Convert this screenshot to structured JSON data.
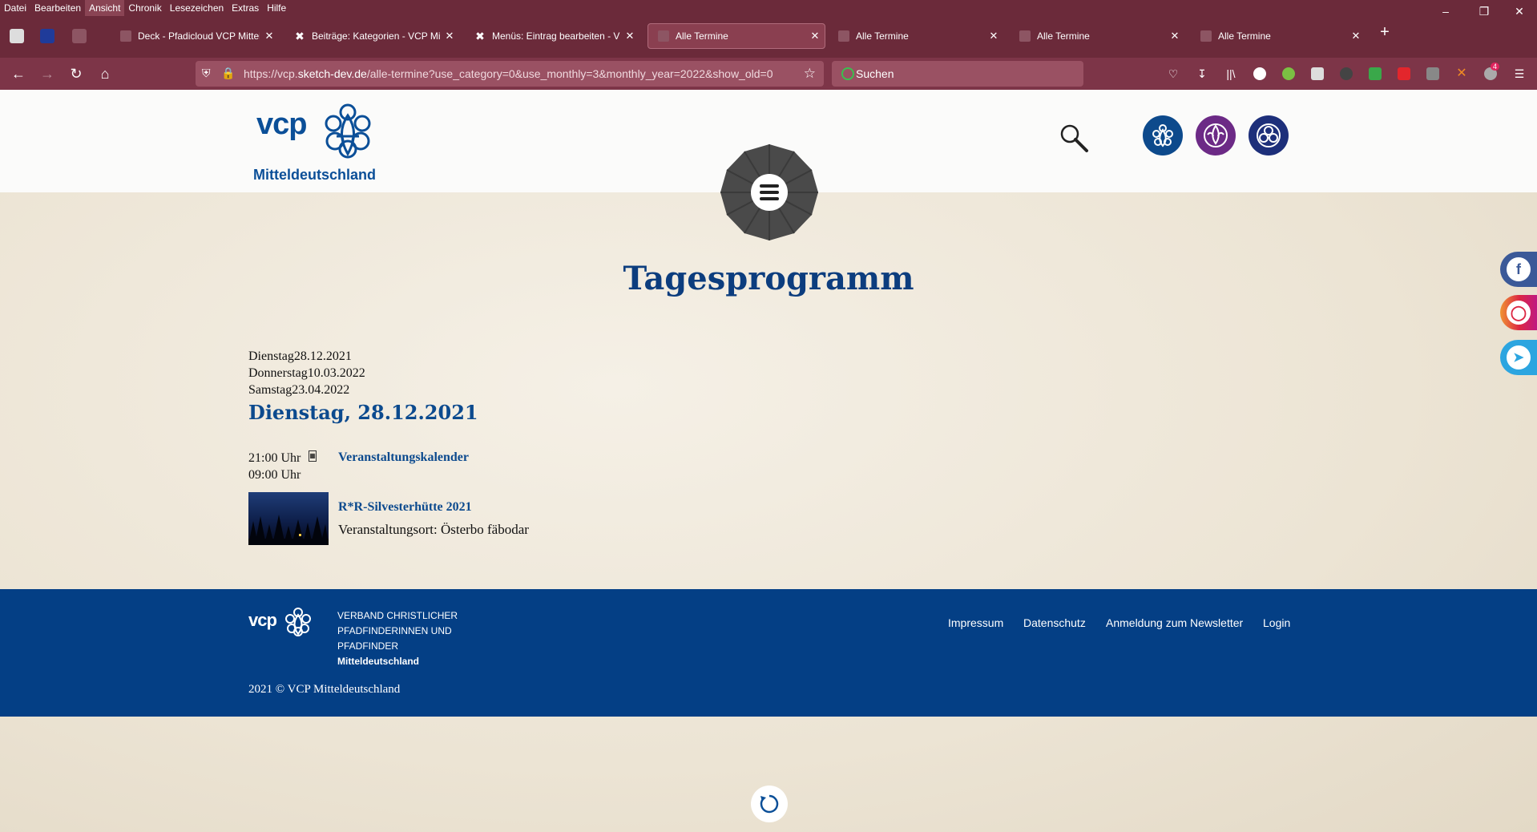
{
  "browser": {
    "menu": [
      "Datei",
      "Bearbeiten",
      "Ansicht",
      "Chronik",
      "Lesezeichen",
      "Extras",
      "Hilfe"
    ],
    "tabs": [
      {
        "label": "Deck - Pfadicloud VCP Mitteldeutschland"
      },
      {
        "label": "Beiträge: Kategorien - VCP Mitteldeutschland"
      },
      {
        "label": "Menüs: Eintrag bearbeiten - VCP"
      },
      {
        "label": "Alle Termine"
      },
      {
        "label": "Alle Termine"
      },
      {
        "label": "Alle Termine"
      },
      {
        "label": "Alle Termine"
      }
    ],
    "url_prefix": "https://vcp.",
    "url_domain": "sketch-dev.de",
    "url_rest": "/alle-termine?use_category=0&use_monthly=3&monthly_year=2022&show_old=0",
    "search_placeholder": "Suchen",
    "notification_count": "4"
  },
  "site": {
    "logo_text": "vcp",
    "logo_sub": "Mitteldeutschland",
    "page_title": "Tagesprogramm"
  },
  "dates": [
    {
      "day": "Dienstag",
      "date": "28.12.2021"
    },
    {
      "day": "Donnerstag",
      "date": "10.03.2022"
    },
    {
      "day": "Samstag",
      "date": "23.04.2022"
    }
  ],
  "day_heading": "Dienstag, 28.12.2021",
  "event": {
    "start_time": "21:00 Uhr",
    "end_time": "09:00 Uhr",
    "category": "Veranstaltungskalender",
    "title": "R*R-Silvesterhütte 2021",
    "place": "Veranstaltungsort: Österbo fäbodar"
  },
  "footer": {
    "logo_text": "vcp",
    "org_line1": "VERBAND CHRISTLICHER",
    "org_line2": "PFADFINDERINNEN UND",
    "org_line3": "PFADFINDER",
    "org_region": "Mitteldeutschland",
    "copyright": "2021 © VCP Mitteldeutschland",
    "links": [
      "Impressum",
      "Datenschutz",
      "Anmeldung zum Newsletter",
      "Login"
    ]
  },
  "colors": {
    "brand_blue": "#0b4f98",
    "footer_blue": "#043f85",
    "browser_bg": "#6b2a3a"
  }
}
